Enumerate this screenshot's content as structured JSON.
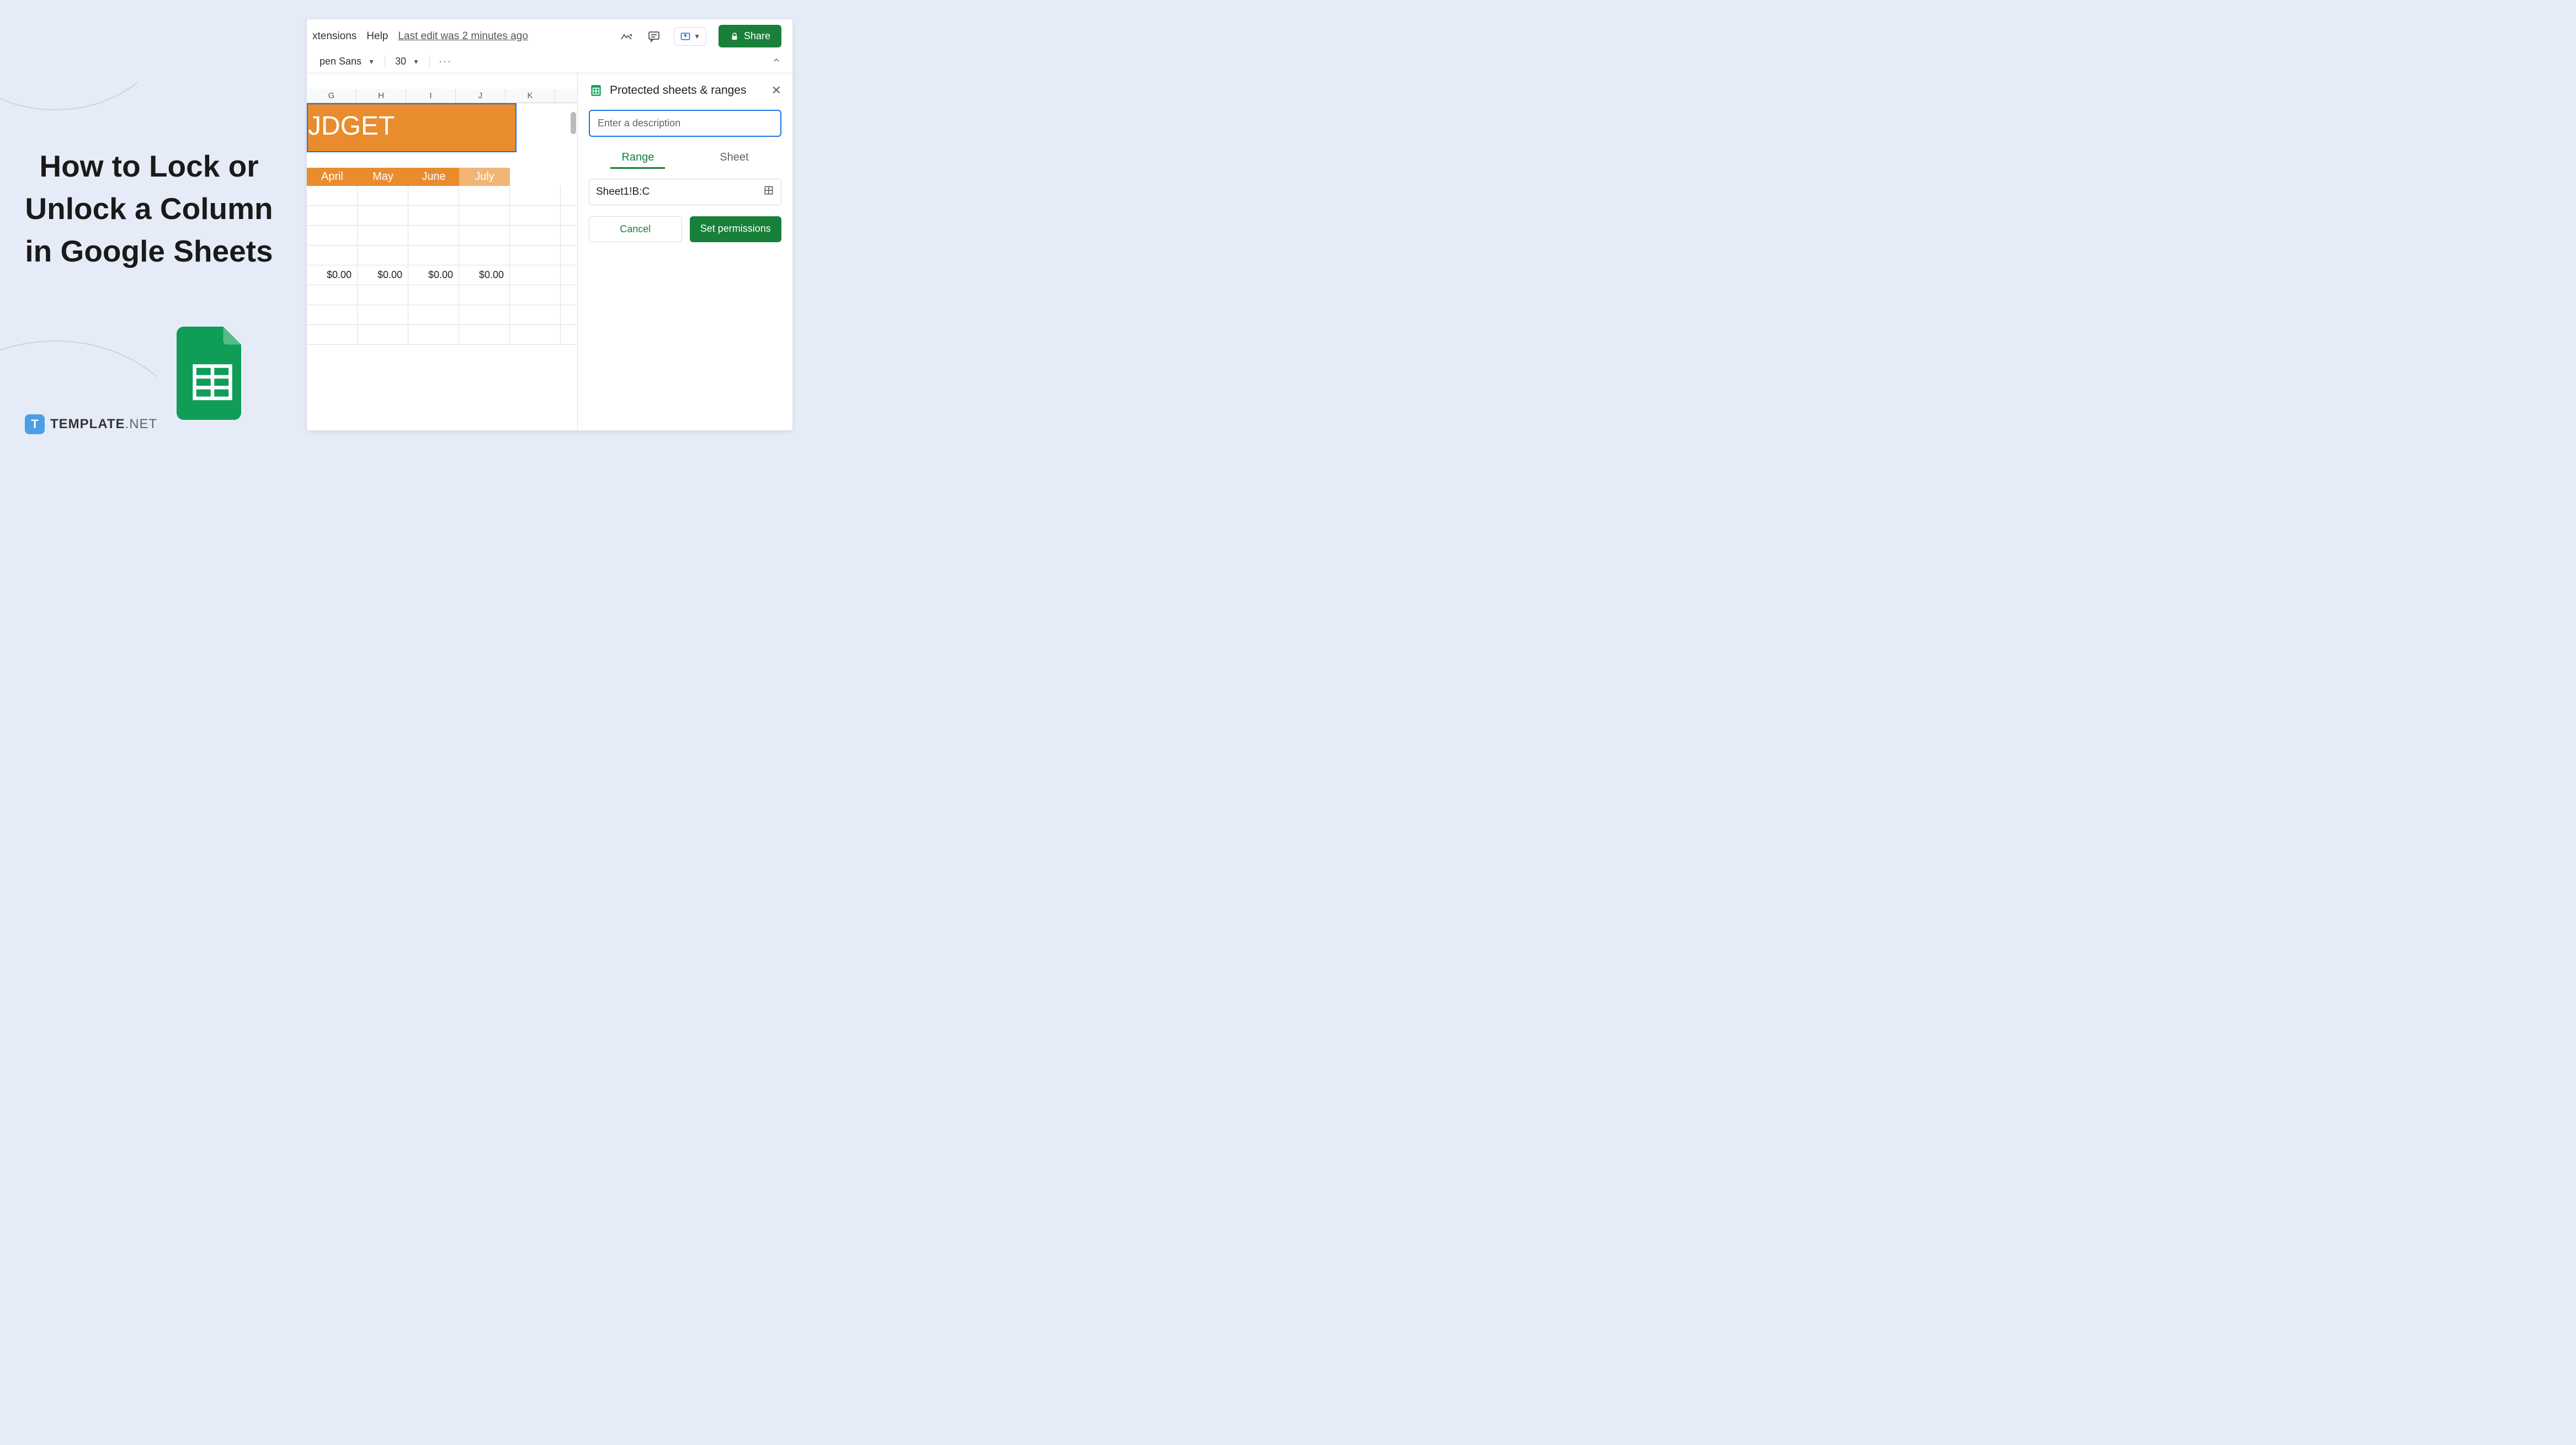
{
  "left": {
    "title": "How to Lock or Unlock a Column in Google Sheets",
    "brand_letter": "T",
    "brand_name": "TEMPLATE",
    "brand_tld": ".NET"
  },
  "menubar": {
    "extensions": "xtensions",
    "help": "Help",
    "last_edit": "Last edit was 2 minutes ago"
  },
  "toolbar": {
    "font": "pen Sans",
    "size": "30",
    "more": "···"
  },
  "actions": {
    "share": "Share"
  },
  "sheet": {
    "columns": [
      "G",
      "H",
      "I",
      "J",
      "K"
    ],
    "banner": "JDGET",
    "months": [
      "April",
      "May",
      "June",
      "July"
    ],
    "values": [
      "$0.00",
      "$0.00",
      "$0.00",
      "$0.00"
    ]
  },
  "panel": {
    "title": "Protected sheets & ranges",
    "placeholder": "Enter a description",
    "tab_range": "Range",
    "tab_sheet": "Sheet",
    "range_value": "Sheet1!B:C",
    "cancel": "Cancel",
    "set_permissions": "Set permissions"
  }
}
